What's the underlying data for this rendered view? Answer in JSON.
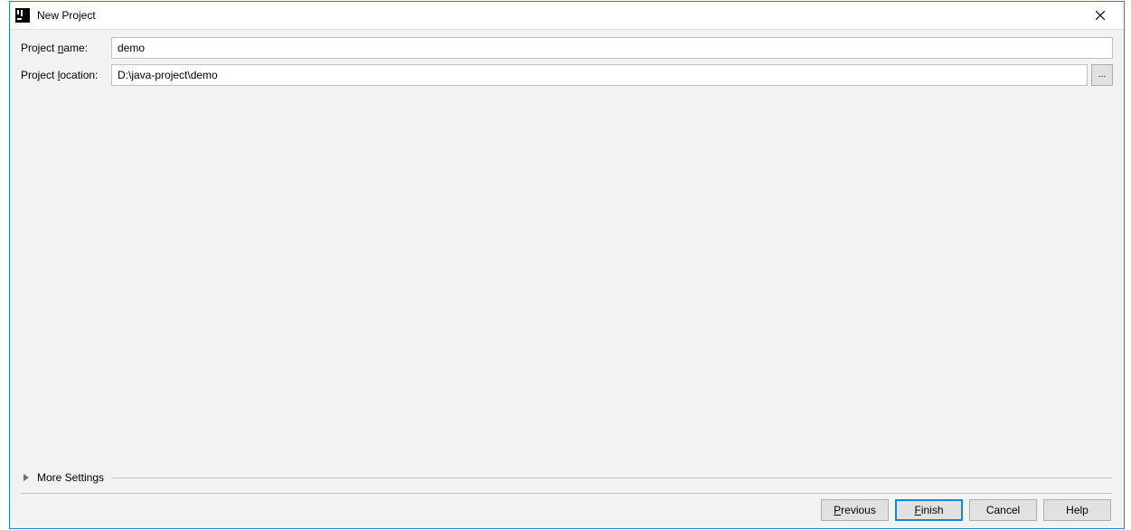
{
  "dialog": {
    "title": "New Project"
  },
  "form": {
    "project_name": {
      "label_prefix": "Project ",
      "label_mnemonic": "n",
      "label_suffix": "ame:",
      "value": "demo"
    },
    "project_location": {
      "label_prefix": "Project ",
      "label_mnemonic": "l",
      "label_suffix": "ocation:",
      "value": "D:\\java-project\\demo"
    },
    "browse_label": "...",
    "more_settings_label": "More Settings"
  },
  "buttons": {
    "previous": {
      "mnemonic": "P",
      "rest": "revious"
    },
    "finish": {
      "mnemonic": "F",
      "rest": "inish"
    },
    "cancel": {
      "text": "Cancel"
    },
    "help": {
      "text": "Help"
    }
  }
}
